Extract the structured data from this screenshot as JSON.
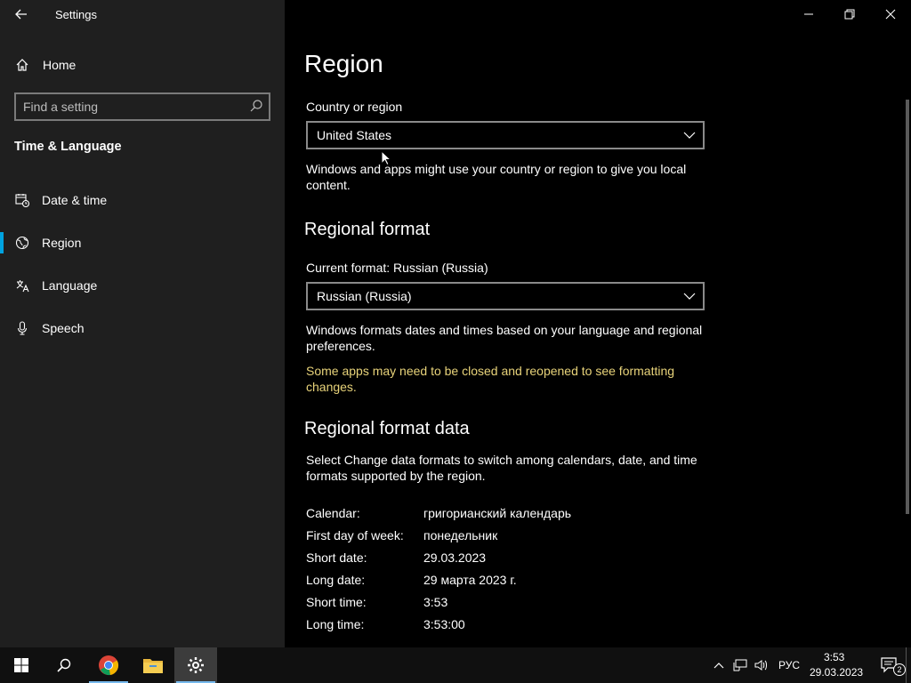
{
  "window": {
    "title": "Settings"
  },
  "sidebar": {
    "home_label": "Home",
    "search_placeholder": "Find a setting",
    "section_title": "Time & Language",
    "items": [
      {
        "label": "Date & time",
        "icon": "calendar-clock-icon"
      },
      {
        "label": "Region",
        "icon": "globe-icon",
        "selected": true
      },
      {
        "label": "Language",
        "icon": "language-icon"
      },
      {
        "label": "Speech",
        "icon": "microphone-icon"
      }
    ]
  },
  "main": {
    "page_title": "Region",
    "country": {
      "label": "Country or region",
      "value": "United States",
      "description": "Windows and apps might use your country or region to give you local content."
    },
    "regional_format": {
      "heading": "Regional format",
      "current_label": "Current format: Russian (Russia)",
      "value": "Russian (Russia)",
      "description": "Windows formats dates and times based on your language and regional preferences.",
      "warning": "Some apps may need to be closed and reopened to see formatting changes."
    },
    "format_data": {
      "heading": "Regional format data",
      "description": "Select Change data formats to switch among calendars, date, and time formats supported by the region.",
      "rows": [
        {
          "label": "Calendar:",
          "value": "григорианский календарь"
        },
        {
          "label": "First day of week:",
          "value": "понедельник"
        },
        {
          "label": "Short date:",
          "value": "29.03.2023"
        },
        {
          "label": "Long date:",
          "value": "29 марта 2023 г."
        },
        {
          "label": "Short time:",
          "value": "3:53"
        },
        {
          "label": "Long time:",
          "value": "3:53:00"
        }
      ]
    }
  },
  "taskbar": {
    "language": "РУС",
    "time": "3:53",
    "date": "29.03.2023",
    "notification_count": "2"
  },
  "colors": {
    "accent": "#00a3e0",
    "warning": "#e8d37a",
    "sidebar_bg": "#1f1f1f"
  }
}
